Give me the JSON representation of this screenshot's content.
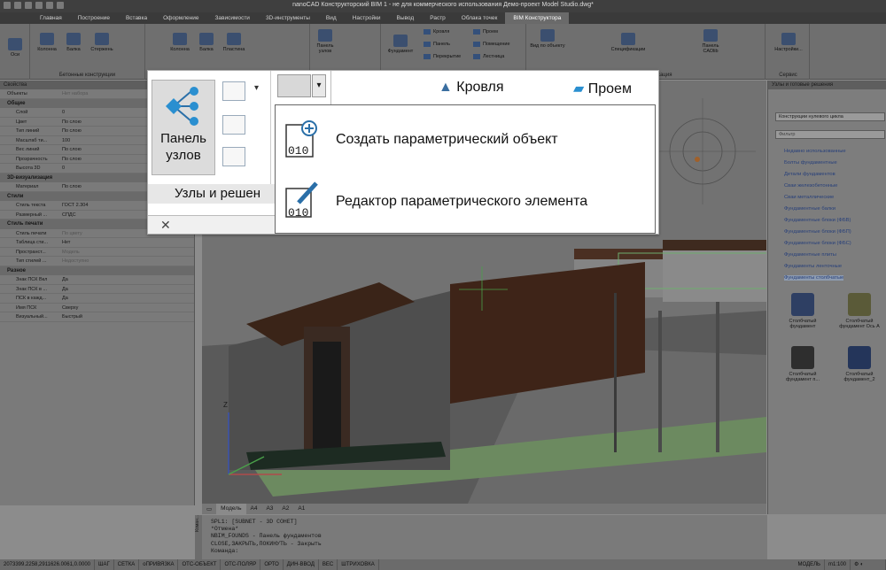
{
  "window": {
    "title": "nanoCAD Конструкторский BIM 1 - не для коммерческого использования Демо-проект Model Studio.dwg*"
  },
  "menu": [
    {
      "label": "Главная"
    },
    {
      "label": "Построение"
    },
    {
      "label": "Вставка"
    },
    {
      "label": "Оформление"
    },
    {
      "label": "Зависимости"
    },
    {
      "label": "3D-инструменты"
    },
    {
      "label": "Вид"
    },
    {
      "label": "Настройки"
    },
    {
      "label": "Вывод"
    },
    {
      "label": "Растр"
    },
    {
      "label": "Облака точек"
    },
    {
      "label": "BIM Конструктора"
    }
  ],
  "ribbon": {
    "axes": "Оси",
    "concrete": {
      "title": "Бетонные конструкции",
      "column": "Колонна",
      "beam": "Балка",
      "rod": "Стержень"
    },
    "g2": {
      "column": "Колонна",
      "beam": "Балка",
      "plate": "Пластина"
    },
    "nodes": "Панель узлов",
    "g4": {
      "foundation": "Фундамент",
      "roof": "Кровля",
      "panel": "Панель",
      "overlap": "Перекрытие",
      "opening": "Проем",
      "room": "Помещение",
      "stair": "Лестница"
    },
    "reports": {
      "title": "Отчеты и публикация",
      "view": "Вид по объекту",
      "spec": "Спецификации",
      "cadlib": "Панель CADlib"
    },
    "service": {
      "title": "Сервис",
      "settings": "Настройки..."
    }
  },
  "props": {
    "header": "Свойства",
    "objects_label": "Объекты",
    "objects_value": "Нет набора",
    "sections": [
      {
        "title": "Общие",
        "rows": [
          {
            "k": "Слой",
            "v": "0"
          },
          {
            "k": "Цвет",
            "v": "По слою"
          },
          {
            "k": "Тип линий",
            "v": "По слою"
          },
          {
            "k": "Масштаб ти...",
            "v": "100"
          },
          {
            "k": "Вес линий",
            "v": "По слою"
          },
          {
            "k": "Прозрачность",
            "v": "По слою"
          },
          {
            "k": "Высота 3D",
            "v": "0"
          }
        ]
      },
      {
        "title": "3D-визуализация",
        "rows": [
          {
            "k": "Материал",
            "v": "По слою"
          }
        ]
      },
      {
        "title": "Стили",
        "rows": [
          {
            "k": "Стиль текста",
            "v": "ГОСТ 2.304"
          },
          {
            "k": "Размерный ...",
            "v": "СПДС"
          }
        ]
      },
      {
        "title": "Стиль печати",
        "rows": [
          {
            "k": "Стиль печати",
            "v": "По цвету"
          },
          {
            "k": "Таблица сти...",
            "v": "Нет"
          },
          {
            "k": "Пространст...",
            "v": "Модель"
          },
          {
            "k": "Тип стилей ...",
            "v": "Недоступно"
          }
        ]
      },
      {
        "title": "Разное",
        "rows": [
          {
            "k": "Знак ПСК Вкл",
            "v": "Да"
          },
          {
            "k": "Знак ПСК в ...",
            "v": "Да"
          },
          {
            "k": "ПСК в кажд...",
            "v": "Да"
          },
          {
            "k": "Имя ПСК",
            "v": "Сверху"
          },
          {
            "k": "Визуальный...",
            "v": "Быстрый"
          }
        ]
      }
    ]
  },
  "viewport": {
    "tabs": [
      "Модель",
      "A4",
      "A3",
      "A2",
      "A1"
    ],
    "axis_z": "Z"
  },
  "right_panel": {
    "header": "Узлы и готовые решения",
    "select": "Конструкции нулевого цикла",
    "filter_placeholder": "Фильтр",
    "categories": [
      "Недавно использованные",
      "Болты фундаментные",
      "Детали фундаментов",
      "Сваи железобетонные",
      "Сваи металлические",
      "Фундаментные балки",
      "Фундаментные блоки (ФБВ)",
      "Фундаментные блоки (ФБП)",
      "Фундаментные блоки (ФБС)",
      "Фундаментные плиты",
      "Фундаменты ленточные",
      "Фундаменты столбчатые"
    ],
    "tiles": [
      {
        "line1": "Столбчатый",
        "line2": "фундамент"
      },
      {
        "line1": "Столбчатый",
        "line2": "фундамент Ось А"
      },
      {
        "line1": "Столбчатый",
        "line2": "фундамент п..."
      },
      {
        "line1": "Столбчатый",
        "line2": "фундамент_2"
      }
    ]
  },
  "command": {
    "side_label": "Коман...",
    "lines": [
      "SPL1: [SUBNET - 3D COHET]",
      "*Отмена*",
      "NBIM_FOUNDS - Панель фундаментов",
      "CLOSE,ЗАКРЫТЬ,ПОКИНУТЬ - Закрыть",
      "Команда:"
    ]
  },
  "status": {
    "coords": "2073399.2258,2911626.0061,0.0000",
    "toggles": [
      "ШАГ",
      "СЕТКА",
      "оПРИВЯЗКА",
      "ОТС-ОБЪЕКТ",
      "ОТС-ПОЛЯР",
      "ОРТО",
      "ДИН-ВВОД",
      "ВЕС",
      "ШТРИХОВКА"
    ],
    "model": "МОДЕЛЬ",
    "scale": "m1:100"
  },
  "zoom": {
    "big_button": "Панель узлов",
    "group_label": "Узлы и решен",
    "top_roof": "Кровля",
    "top_opening": "Проем",
    "menu_items": [
      "Создать параметрический объект",
      "Редактор параметрического элемента"
    ],
    "icon_text": "010"
  }
}
